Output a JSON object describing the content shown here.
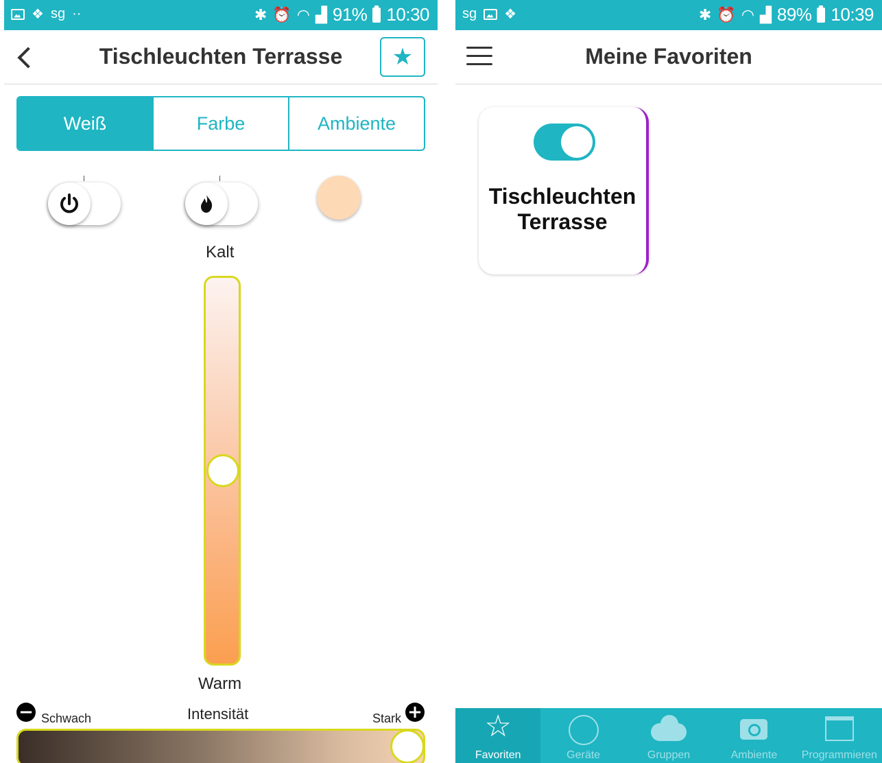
{
  "left_screen": {
    "statusbar": {
      "battery": "91%",
      "time": "10:30"
    },
    "header": {
      "title": "Tischleuchten Terrasse"
    },
    "tabs": [
      {
        "label": "Weiß",
        "active": true
      },
      {
        "label": "Farbe",
        "active": false
      },
      {
        "label": "Ambiente",
        "active": false
      }
    ],
    "controls": {
      "power_icon": "power-icon",
      "flame_icon": "flame-icon",
      "color_swatch": "#fdd9b5"
    },
    "temperature": {
      "top_label": "Kalt",
      "bottom_label": "Warm",
      "level_from_top_percent": 50
    },
    "intensity": {
      "title": "Intensität",
      "min_label": "Schwach",
      "max_label": "Stark",
      "level_percent": 100
    }
  },
  "right_screen": {
    "statusbar": {
      "battery": "89%",
      "time": "10:39"
    },
    "header": {
      "title": "Meine Favoriten"
    },
    "favorite_card": {
      "title_line1": "Tischleuchten",
      "title_line2": "Terrasse",
      "toggle_on": true
    },
    "bottom_nav": [
      {
        "label": "Favoriten",
        "icon": "star-icon",
        "active": true
      },
      {
        "label": "Geräte",
        "icon": "circle-icon",
        "active": false
      },
      {
        "label": "Gruppen",
        "icon": "cloud-icon",
        "active": false
      },
      {
        "label": "Ambiente",
        "icon": "camera-icon",
        "active": false
      },
      {
        "label": "Programmieren",
        "icon": "calendar-icon",
        "active": false
      }
    ]
  },
  "colors": {
    "accent": "#1fb5c3",
    "slider_border": "#d8d81e",
    "card_edge": "#a020c8"
  }
}
